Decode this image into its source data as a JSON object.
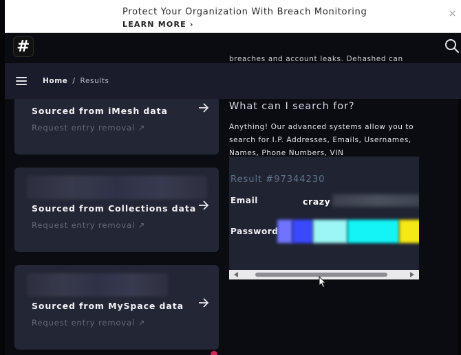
{
  "banner": {
    "title": "Protect Your Organization With Breach Monitoring",
    "cta": "LEARN MORE ›",
    "close": "×"
  },
  "header": {
    "logo_glyph": "#",
    "peek_text": "breaches and account leaks. Dehashed can"
  },
  "breadcrumb": {
    "home": "Home",
    "separator": "/",
    "current": "Results"
  },
  "cards": [
    {
      "title": "Sourced from iMesh data",
      "link": "Request entry removal ↗"
    },
    {
      "title": "Sourced from Collections data",
      "link": "Request entry removal ↗"
    },
    {
      "title": "Sourced from MySpace data",
      "link": "Request entry removal ↗"
    }
  ],
  "info": {
    "heading": "What can I search for?",
    "description": "Anything! Our advanced systems allow you to search for I.P. Addresses, Emails, Usernames, Names, Phone Numbers, VIN"
  },
  "result": {
    "title": "Result #97344230",
    "email_label": "Email",
    "email_value": "crazy",
    "password_label": "Password"
  },
  "colors": {
    "background": "#0b0c12",
    "nav": "#1b1c2b",
    "card": "#232634",
    "accent_result": "#5d7488"
  }
}
